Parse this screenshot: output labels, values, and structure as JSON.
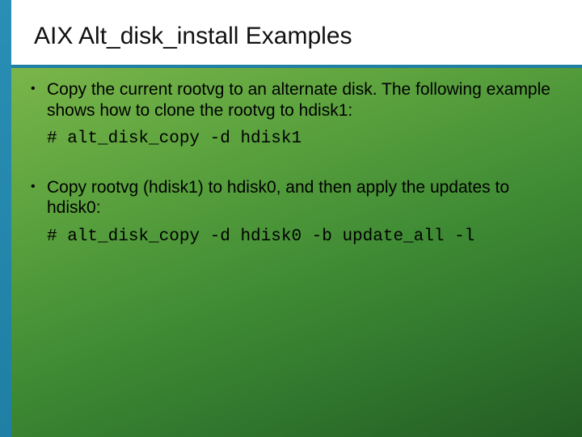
{
  "title": "AIX Alt_disk_install Examples",
  "items": [
    {
      "desc": "Copy the current rootvg to an alternate disk. The following example shows how to clone the rootvg to hdisk1:",
      "cmd": "# alt_disk_copy -d hdisk1"
    },
    {
      "desc": "Copy rootvg (hdisk1) to hdisk0, and then apply the updates to hdisk0:",
      "cmd": "# alt_disk_copy -d hdisk0 -b update_all -l"
    }
  ]
}
